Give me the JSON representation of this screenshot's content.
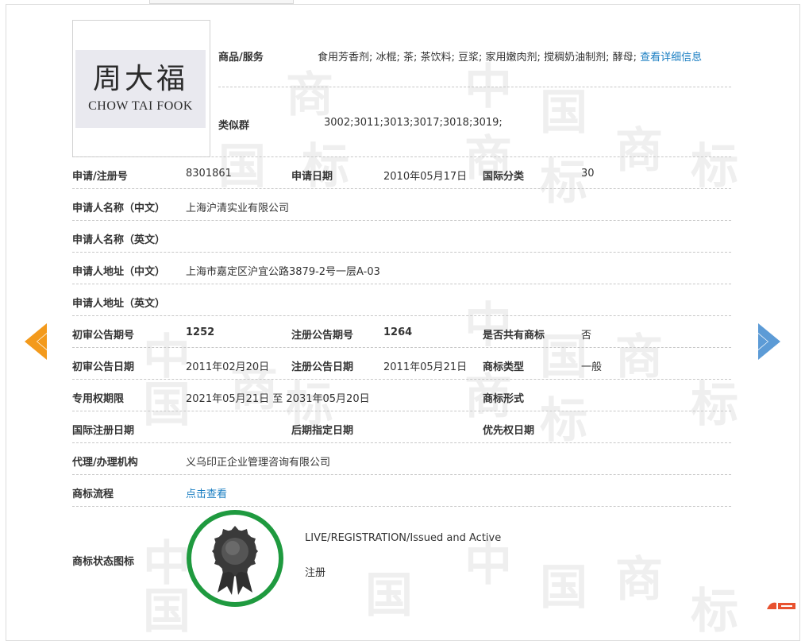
{
  "watermark_chars": [
    "中",
    "国",
    "商",
    "标"
  ],
  "logo": {
    "chinese": "周大福",
    "english": "CHOW TAI FOOK"
  },
  "goods": {
    "label": "商品/服务",
    "value": "食用芳香剂; 冰棍; 茶; 茶饮料; 豆浆; 家用嫩肉剂; 搅稠奶油制剂; 酵母;",
    "link": "查看详细信息"
  },
  "similar": {
    "label": "类似群",
    "value": "3002;3011;3013;3017;3018;3019;"
  },
  "rows": {
    "reg_no": {
      "label": "申请/注册号",
      "value": "8301861"
    },
    "apply_date": {
      "label": "申请日期",
      "value": "2010年05月17日"
    },
    "intl_class": {
      "label": "国际分类",
      "value": "30"
    },
    "applicant_cn": {
      "label": "申请人名称（中文）",
      "value": "上海沪清实业有限公司"
    },
    "applicant_en": {
      "label": "申请人名称（英文）",
      "value": ""
    },
    "address_cn": {
      "label": "申请人地址（中文）",
      "value": "上海市嘉定区沪宜公路3879-2号一层A-03"
    },
    "address_en": {
      "label": "申请人地址（英文）",
      "value": ""
    },
    "prelim_no": {
      "label": "初审公告期号",
      "value": "1252"
    },
    "reg_pub_no": {
      "label": "注册公告期号",
      "value": "1264"
    },
    "shared": {
      "label": "是否共有商标",
      "value": "否"
    },
    "prelim_date": {
      "label": "初审公告日期",
      "value": "2011年02月20日"
    },
    "reg_pub_date": {
      "label": "注册公告日期",
      "value": "2011年05月21日"
    },
    "tm_type": {
      "label": "商标类型",
      "value": "一般"
    },
    "exclusive": {
      "label": "专用权期限",
      "value": "2021年05月21日 至 2031年05月20日"
    },
    "tm_form": {
      "label": "商标形式",
      "value": ""
    },
    "intl_reg_date": {
      "label": "国际注册日期",
      "value": ""
    },
    "later_date": {
      "label": "后期指定日期",
      "value": ""
    },
    "priority_date": {
      "label": "优先权日期",
      "value": ""
    },
    "agent": {
      "label": "代理/办理机构",
      "value": "义乌印正企业管理咨询有限公司"
    },
    "process": {
      "label": "商标流程",
      "link": "点击查看"
    }
  },
  "status": {
    "label": "商标状态图标",
    "english": "LIVE/REGISTRATION/Issued and Active",
    "chinese": "注册"
  },
  "colors": {
    "ring": "#1f9a3f",
    "prev_arrow": "#f39a1c",
    "next_arrow": "#5c9bd6",
    "link": "#1a7ec2"
  },
  "icons": {
    "prev": "left-triangle-arrow",
    "next": "right-triangle-arrow",
    "status": "award-ribbon-badge"
  }
}
